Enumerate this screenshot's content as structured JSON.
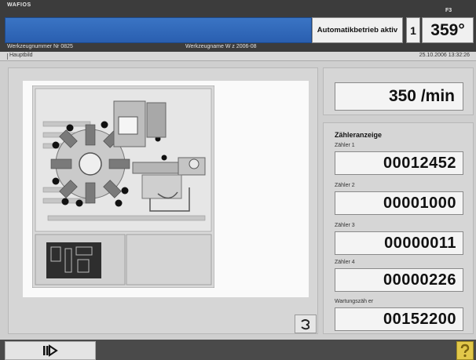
{
  "header": {
    "logo_text": "WAFIOS",
    "f_key_label": "F3",
    "mode_label": "Automatikbetrieb aktiv",
    "channel_number": "1",
    "angle_value": "359°",
    "tool_number": "Werkzeugnummer Nr 0825",
    "tool_name": "Werkzeugname W  z 2006-08"
  },
  "crumbbar": {
    "breadcrumb": "Hauptbild",
    "datetime": "25.10.2006  13:32:26"
  },
  "speed": {
    "value": "350 /min"
  },
  "counters": {
    "title": "Zähleranzeige",
    "items": [
      {
        "label": "Zähler 1",
        "value": "00012452"
      },
      {
        "label": "Zähler 2",
        "value": "00001000"
      },
      {
        "label": "Zähler 3",
        "value": "00000011"
      },
      {
        "label": "Zähler 4",
        "value": "00000226"
      },
      {
        "label": "Wartungszäh er",
        "value": "00152200"
      }
    ]
  },
  "icons": {
    "print": "printer-icon",
    "softkey": "play-step-icon",
    "help": "help-icon"
  },
  "colors": {
    "header_bg": "#3c3c3c",
    "blue_bar": "#2f66b8",
    "panel_bg": "#d6d6d6",
    "help_yellow": "#e2c84a"
  }
}
